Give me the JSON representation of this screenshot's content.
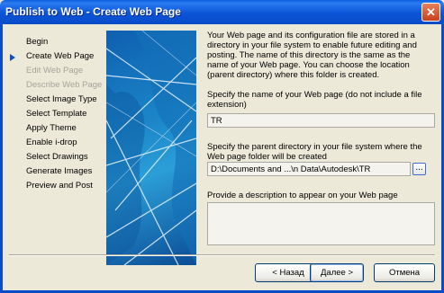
{
  "window": {
    "title": "Publish to Web - Create Web Page"
  },
  "steps": [
    {
      "label": "Begin",
      "enabled": true,
      "current": false
    },
    {
      "label": "Create Web Page",
      "enabled": true,
      "current": true
    },
    {
      "label": "Edit Web Page",
      "enabled": false,
      "current": false
    },
    {
      "label": "Describe Web Page",
      "enabled": false,
      "current": false
    },
    {
      "label": "Select Image Type",
      "enabled": true,
      "current": false
    },
    {
      "label": "Select Template",
      "enabled": true,
      "current": false
    },
    {
      "label": "Apply Theme",
      "enabled": true,
      "current": false
    },
    {
      "label": "Enable i-drop",
      "enabled": true,
      "current": false
    },
    {
      "label": "Select Drawings",
      "enabled": true,
      "current": false
    },
    {
      "label": "Generate Images",
      "enabled": true,
      "current": false
    },
    {
      "label": "Preview and Post",
      "enabled": true,
      "current": false
    }
  ],
  "content": {
    "intro": "Your Web page and its configuration file are stored in a directory in your file system to enable future editing and posting. The name of this directory is the same as the name of your Web page. You can choose the location (parent directory) where this folder is created.",
    "name_label": "Specify the name of your Web page (do not include a file extension)",
    "name_value": "TR",
    "dir_label": "Specify the parent directory in your file system where the Web page folder will be created",
    "dir_value": "D:\\Documents and ...\\n Data\\Autodesk\\TR",
    "browse_label": "...",
    "desc_label": "Provide a description to appear on your Web page",
    "desc_value": ""
  },
  "buttons": {
    "back": "< Назад",
    "next": "Далее >",
    "cancel": "Отмена"
  }
}
